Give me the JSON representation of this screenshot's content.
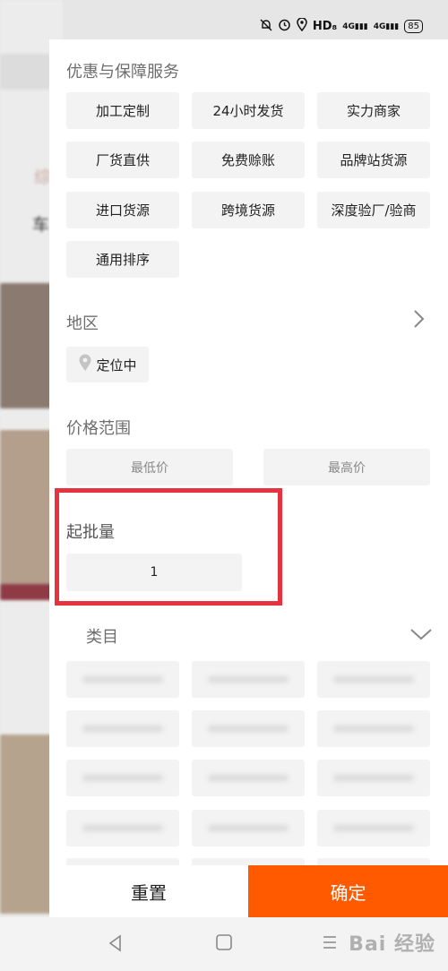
{
  "status_bar": {
    "icons": [
      "mute-icon",
      "alarm-icon",
      "location-icon"
    ],
    "hd_label": "HD₈",
    "signal_1": "4G",
    "signal_2": "4G",
    "battery": "85"
  },
  "background": {
    "char_1": "综",
    "char_2": "车"
  },
  "services": {
    "title": "优惠与保障服务",
    "tags": [
      "加工定制",
      "24小时发货",
      "实力商家",
      "厂货直供",
      "免费赊账",
      "品牌站货源",
      "进口货源",
      "跨境货源",
      "深度验厂/验商",
      "通用排序"
    ]
  },
  "region": {
    "title": "地区",
    "location_label": "定位中"
  },
  "price": {
    "title": "价格范围",
    "min_placeholder": "最低价",
    "max_placeholder": "最高价"
  },
  "moq": {
    "title": "起批量",
    "value": "1"
  },
  "category": {
    "title": "类目"
  },
  "footer": {
    "reset_label": "重置",
    "confirm_label": "确定"
  },
  "watermark": "Bai 经验",
  "colors": {
    "confirm": "#ff5a00",
    "highlight": "#e5333f"
  }
}
